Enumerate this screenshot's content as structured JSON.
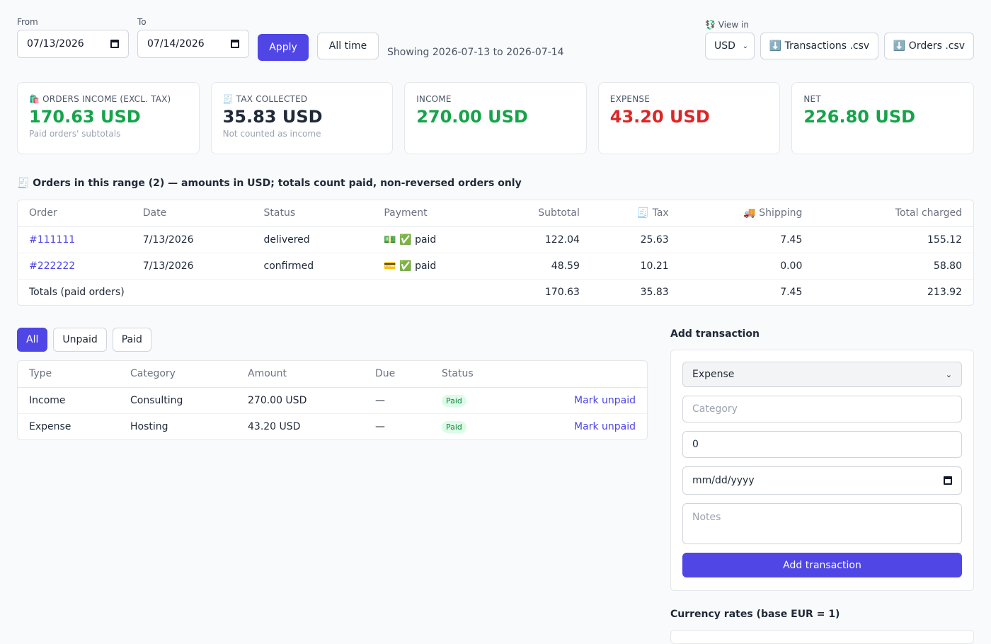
{
  "filters": {
    "from_label": "From",
    "from_value": "07/13/2026",
    "to_label": "To",
    "to_value": "07/14/2026",
    "apply_label": "Apply",
    "all_time_label": "All time",
    "showing_text": "Showing 2026-07-13 to 2026-07-14",
    "view_in_label": "💱 View in",
    "currency_value": "USD",
    "transactions_csv_label": "⬇️ Transactions .csv",
    "orders_csv_label": "⬇️ Orders .csv"
  },
  "cards": [
    {
      "label": "🛍️ ORDERS INCOME (EXCL. TAX)",
      "value": "170.63 USD",
      "sub": "Paid orders' subtotals",
      "color": "#16a34a"
    },
    {
      "label": "🧾 TAX COLLECTED",
      "value": "35.83 USD",
      "sub": "Not counted as income",
      "color": "#1f2937"
    },
    {
      "label": "INCOME",
      "value": "270.00 USD",
      "sub": "",
      "color": "#16a34a"
    },
    {
      "label": "EXPENSE",
      "value": "43.20 USD",
      "sub": "",
      "color": "#dc2626"
    },
    {
      "label": "NET",
      "value": "226.80 USD",
      "sub": "",
      "color": "#16a34a"
    }
  ],
  "orders": {
    "title": "🧾 Orders in this range (2) — amounts in USD; totals count paid, non-reversed orders only",
    "headers": {
      "order": "Order",
      "date": "Date",
      "status": "Status",
      "payment": "Payment",
      "subtotal": "Subtotal",
      "tax": "🧾 Tax",
      "shipping": "🚚 Shipping",
      "total": "Total charged"
    },
    "rows": [
      {
        "order": "#111111",
        "date": "7/13/2026",
        "status": "delivered",
        "payment": "💵 ✅ paid",
        "subtotal": "122.04",
        "tax": "25.63",
        "shipping": "7.45",
        "total": "155.12"
      },
      {
        "order": "#222222",
        "date": "7/13/2026",
        "status": "confirmed",
        "payment": "💳 ✅ paid",
        "subtotal": "48.59",
        "tax": "10.21",
        "shipping": "0.00",
        "total": "58.80"
      }
    ],
    "totals": {
      "label": "Totals (paid orders)",
      "subtotal": "170.63",
      "tax": "35.83",
      "shipping": "7.45",
      "total": "213.92"
    }
  },
  "tx_tabs": [
    "All",
    "Unpaid",
    "Paid"
  ],
  "transactions": {
    "headers": {
      "type": "Type",
      "category": "Category",
      "amount": "Amount",
      "due": "Due",
      "status": "Status"
    },
    "rows": [
      {
        "type": "Income",
        "category": "Consulting",
        "amount": "270.00 USD",
        "due": "—",
        "status": "Paid",
        "action": "Mark unpaid"
      },
      {
        "type": "Expense",
        "category": "Hosting",
        "amount": "43.20 USD",
        "due": "—",
        "status": "Paid",
        "action": "Mark unpaid"
      }
    ]
  },
  "add_tx": {
    "title": "Add transaction",
    "type_value": "Expense",
    "category_placeholder": "Category",
    "amount_value": "0",
    "date_placeholder": "mm/dd/yyyy",
    "notes_placeholder": "Notes",
    "submit_label": "Add transaction"
  },
  "currency_rates_title": "Currency rates (base EUR = 1)"
}
